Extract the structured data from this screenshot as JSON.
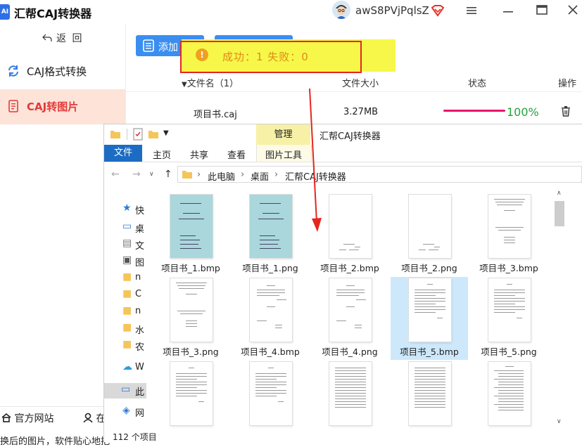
{
  "app": {
    "title": "汇帮CAJ转换器",
    "username": "awS8PVjPqlsZ"
  },
  "sidebar": {
    "back_label": "返  回",
    "items": [
      {
        "label": "CAJ格式转换",
        "icon": "refresh-icon"
      },
      {
        "label": "CAJ转图片",
        "icon": "document-icon"
      }
    ],
    "footer": {
      "website": "官方网站",
      "partial": "在",
      "bottom_text": "换后的图片，软件贴心地把"
    }
  },
  "toolbar": {
    "add_label": "添加"
  },
  "table": {
    "headers": {
      "filename": "文件名（1）",
      "size": "文件大小",
      "status": "状态",
      "action": "操作"
    },
    "rows": [
      {
        "filename": "项目书.caj",
        "size": "3.27MB",
        "progress": 1.0,
        "progress_label": "100%"
      }
    ]
  },
  "toast": {
    "text": "成功：1   失败：0"
  },
  "explorer": {
    "context_tab": "管理",
    "window_title": "汇帮CAJ转换器",
    "tabs": [
      "文件",
      "主页",
      "共享",
      "查看",
      "图片工具"
    ],
    "breadcrumb": [
      "此电脑",
      "桌面",
      "汇帮CAJ转换器"
    ],
    "nav_items": [
      "快",
      "桌",
      "文",
      "图",
      "n",
      "C",
      "n",
      "水",
      "农",
      "W",
      "此",
      "网"
    ],
    "status": "112 个项目",
    "files": [
      {
        "name": "项目书_1.bmp",
        "style": "teal"
      },
      {
        "name": "项目书_1.png",
        "style": "teal"
      },
      {
        "name": "项目书_2.bmp",
        "style": "signature"
      },
      {
        "name": "项目书_2.png",
        "style": "signature"
      },
      {
        "name": "项目书_3.bmp",
        "style": "titlepage"
      },
      {
        "name": "项目书_3.png",
        "style": "titlepage"
      },
      {
        "name": "项目书_4.bmp",
        "style": "abstract"
      },
      {
        "name": "项目书_4.png",
        "style": "abstract"
      },
      {
        "name": "项目书_5.bmp",
        "style": "text",
        "selected": true
      },
      {
        "name": "项目书_5.png",
        "style": "text"
      },
      {
        "name": "",
        "style": "text"
      },
      {
        "name": "",
        "style": "text"
      },
      {
        "name": "",
        "style": "dense"
      },
      {
        "name": "",
        "style": "dense"
      },
      {
        "name": "",
        "style": "toc"
      }
    ]
  }
}
